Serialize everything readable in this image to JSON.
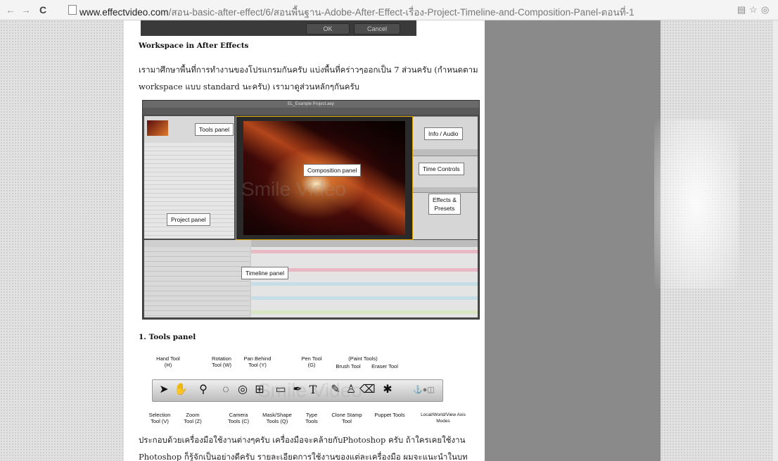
{
  "browser": {
    "url_domain": "www.effectvideo.com",
    "url_path": "/สอน-basic-after-effect/6/สอนพื้นฐาน-Adobe-After-Effect-เรื่อง-Project-Timeline-and-Composition-Panel-ตอนที่-1",
    "back_icon": "←",
    "forward_icon": "→",
    "reload_icon": "C"
  },
  "article": {
    "top_buttons": {
      "ok": "OK",
      "cancel": "Cancel"
    },
    "heading_workspace": "Workspace in After Effects",
    "para_workspace": "เรามาศึกษาพื้นที่การทำงานของโปรแกรมกันครับ แบ่งพื้นที่คร่าวๆออกเป็น 7 ส่วนครับ (กำหนดตาม workspace แบบ standard นะครับ) เรามาดูส่วนหลักๆกันครับ",
    "screenshot_title": "EL_Example Project.aep",
    "callouts": {
      "tools_panel": "Tools panel",
      "info_audio": "Info / Audio",
      "composition_panel": "Composition panel",
      "time_controls": "Time Controls",
      "effects_presets": "Effects &\nPresets",
      "project_panel": "Project panel",
      "timeline_panel": "Timeline panel"
    },
    "watermark": "Smile Video",
    "heading_tools": "1. Tools panel",
    "tools_labels_top": [
      "Hand Tool\n(H)",
      "Rotation\nTool (W)",
      "Pan Behind\nTool (Y)",
      "Pen Tool\n(G)",
      "(Paint Tools)",
      "Brush Tool",
      "Eraser Tool"
    ],
    "tools_labels_bottom": [
      "Selection\nTool (V)",
      "Zoom\nTool (Z)",
      "Camera\nTools (C)",
      "Mask/Shape\nTools (Q)",
      "Type\nTools",
      "Clone Stamp\nTool",
      "Puppet Tools",
      "Local/World/View Axis\nModes"
    ],
    "para_tools": "ประกอบด้วยเครื่องมือใช้งานต่างๆครับ เครื่องมือจะคล้ายกับPhotoshop ครับ ถ้าใครเคยใช้งาน Photoshop ก็รู้จักเป็นอย่างดีครับ รายละเอียดการใช้งานของแต่ละเครื่องมือ ผมจะแนะนำในบทต่อๆไปครับ"
  }
}
